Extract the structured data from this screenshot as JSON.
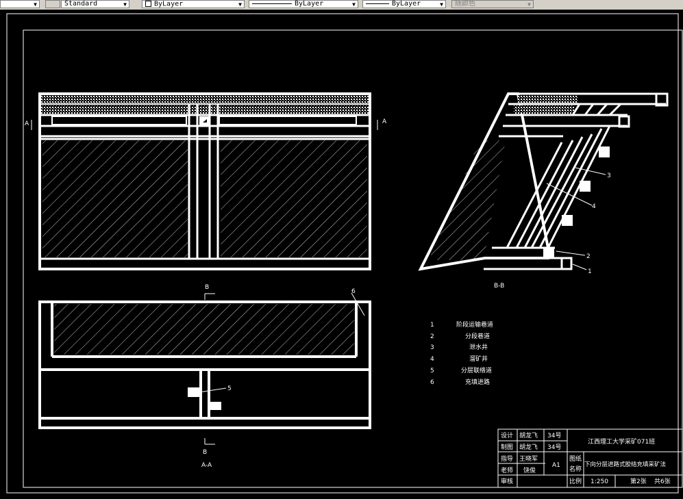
{
  "toolbar": {
    "text_style": "Standard",
    "layer": "ByLayer",
    "linetype": "ByLayer",
    "lineweight": "ByLayer",
    "color": "随颜色"
  },
  "drawing": {
    "section_labels": {
      "a_left": "A",
      "a_right": "A",
      "b_top": "B",
      "b_bottom": "B",
      "view_bb": "B-B",
      "view_aa": "A-A"
    },
    "callouts": [
      "1",
      "2",
      "3",
      "4",
      "5",
      "6"
    ],
    "legend": [
      {
        "num": "1",
        "name": "阶段运输巷道"
      },
      {
        "num": "2",
        "name": "分段巷道"
      },
      {
        "num": "3",
        "name": "泄水井"
      },
      {
        "num": "4",
        "name": "溜矿井"
      },
      {
        "num": "5",
        "name": "分层联络道"
      },
      {
        "num": "6",
        "name": "充填进路"
      }
    ]
  },
  "title_block": {
    "design_label": "设计",
    "design_name": "胡龙飞",
    "design_no": "34号",
    "draw_label": "制图",
    "draw_name": "胡龙飞",
    "draw_no": "34号",
    "guide_label": "指导",
    "guide_name": "王晓军",
    "teacher_label": "老师",
    "teacher_name": "饶俊",
    "review_label": "审核",
    "school": "江西理工大学采矿071班",
    "size": "A1",
    "drawing_name_label_1": "图纸",
    "drawing_name_label_2": "名称",
    "drawing_name": "下向分层进路式胶结充填采矿法",
    "scale_label": "比例",
    "scale": "1:250",
    "sheet": "第2张",
    "total": "共6张"
  }
}
